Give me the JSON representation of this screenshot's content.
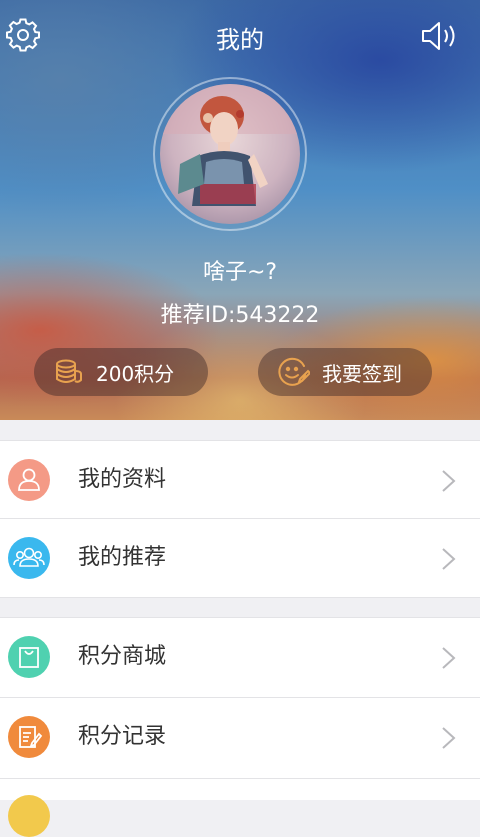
{
  "topbar": {
    "title": "我的",
    "settings_icon": "gear-icon",
    "sound_icon": "speaker-icon"
  },
  "profile": {
    "nickname": "啥子~?",
    "referral_id": "推荐ID:543222"
  },
  "actions": {
    "points_label": "200积分",
    "checkin_label": "我要签到"
  },
  "menu": {
    "group1": [
      {
        "label": "我的资料",
        "icon": "user-icon",
        "color": "#f49a86"
      },
      {
        "label": "我的推荐",
        "icon": "group-icon",
        "color": "#3ab8ee"
      }
    ],
    "group2": [
      {
        "label": "积分商城",
        "icon": "shopping-bag-icon",
        "color": "#4fd1b0"
      },
      {
        "label": "积分记录",
        "icon": "note-edit-icon",
        "color": "#f08a3c"
      }
    ]
  }
}
